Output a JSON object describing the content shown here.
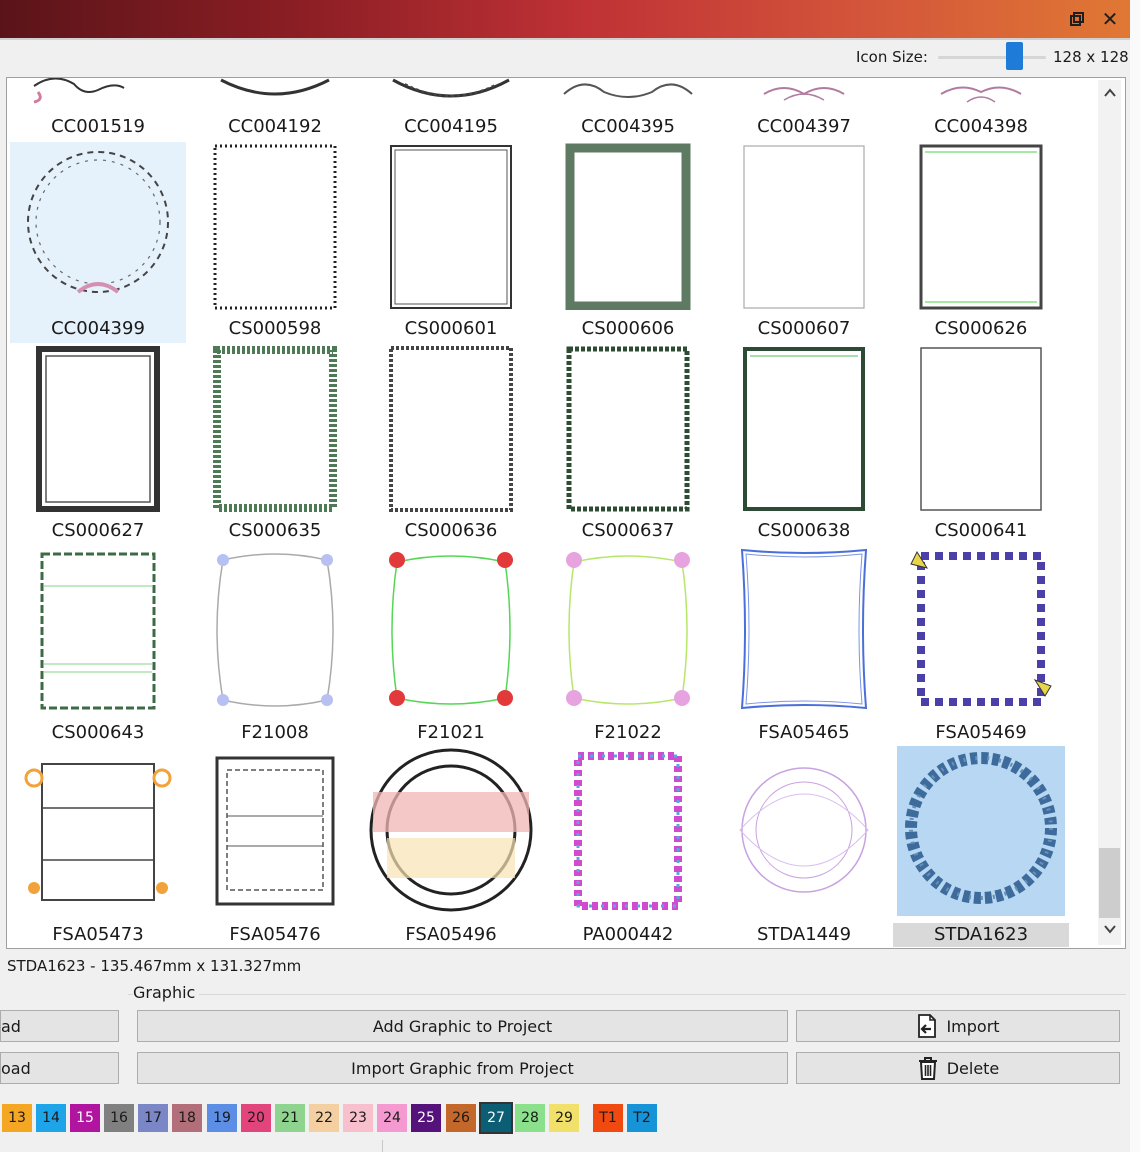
{
  "window": {
    "restore_icon": "restore-window-icon",
    "close_icon": "close-icon",
    "close_glyph": "✕"
  },
  "icon_size": {
    "label": "Icon Size:",
    "value_text": "128 x 128",
    "slider_fraction": 0.75
  },
  "grid": {
    "rows": [
      [
        "CC001519",
        "CC004192",
        "CC004195",
        "CC004395",
        "CC004397",
        "CC004398"
      ],
      [
        "CC004399",
        "CS000598",
        "CS000601",
        "CS000606",
        "CS000607",
        "CS000626"
      ],
      [
        "CS000627",
        "CS000635",
        "CS000636",
        "CS000637",
        "CS000638",
        "CS000641"
      ],
      [
        "CS000643",
        "F21008",
        "F21021",
        "F21022",
        "FSA05465",
        "FSA05469"
      ],
      [
        "FSA05473",
        "FSA05476",
        "FSA05496",
        "PA000442",
        "STDA1449",
        "STDA1623"
      ]
    ],
    "selected": "STDA1623",
    "highlighted": "CC004399"
  },
  "status": {
    "text": "STDA1623 - 135.467mm x 131.327mm"
  },
  "graphic": {
    "group_label": "Graphic",
    "add_button": "Add Graphic to Project",
    "import_from_project_button": "Import Graphic from Project",
    "import_button": "Import",
    "delete_button": "Delete",
    "left_top_partial": "ad",
    "left_bottom_partial": "oad"
  },
  "palette": [
    {
      "label": "13",
      "color": "#f5a623"
    },
    {
      "label": "14",
      "color": "#1ea5e9"
    },
    {
      "label": "15",
      "color": "#b1149e"
    },
    {
      "label": "16",
      "color": "#808080"
    },
    {
      "label": "17",
      "color": "#7b86c6"
    },
    {
      "label": "18",
      "color": "#b26f79"
    },
    {
      "label": "19",
      "color": "#5c8ee6"
    },
    {
      "label": "20",
      "color": "#e2457c"
    },
    {
      "label": "21",
      "color": "#8ed38e"
    },
    {
      "label": "22",
      "color": "#f4cfa1"
    },
    {
      "label": "23",
      "color": "#f7c0cc"
    },
    {
      "label": "24",
      "color": "#f49ad0"
    },
    {
      "label": "25",
      "color": "#55127a"
    },
    {
      "label": "26",
      "color": "#c4672a"
    },
    {
      "label": "27",
      "color": "#0b5e73"
    },
    {
      "label": "28",
      "color": "#8be08b"
    },
    {
      "label": "29",
      "color": "#f1e069"
    },
    {
      "label": "T1",
      "color": "#f04a10"
    },
    {
      "label": "T2",
      "color": "#1793d8"
    }
  ],
  "palette_selected": "27"
}
